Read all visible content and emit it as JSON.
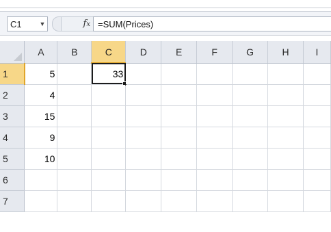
{
  "formula_bar": {
    "name_box": "C1",
    "fx_label": "fx",
    "formula": "=SUM(Prices)"
  },
  "columns": [
    "A",
    "B",
    "C",
    "D",
    "E",
    "F",
    "G",
    "H",
    "I"
  ],
  "rows": [
    {
      "label": "1",
      "cells": [
        "5",
        "",
        "33",
        "",
        "",
        "",
        "",
        "",
        ""
      ]
    },
    {
      "label": "2",
      "cells": [
        "4",
        "",
        "",
        "",
        "",
        "",
        "",
        "",
        ""
      ]
    },
    {
      "label": "3",
      "cells": [
        "15",
        "",
        "",
        "",
        "",
        "",
        "",
        "",
        ""
      ]
    },
    {
      "label": "4",
      "cells": [
        "9",
        "",
        "",
        "",
        "",
        "",
        "",
        "",
        ""
      ]
    },
    {
      "label": "5",
      "cells": [
        "10",
        "",
        "",
        "",
        "",
        "",
        "",
        "",
        ""
      ]
    },
    {
      "label": "6",
      "cells": [
        "",
        "",
        "",
        "",
        "",
        "",
        "",
        "",
        ""
      ]
    },
    {
      "label": "7",
      "cells": [
        "",
        "",
        "",
        "",
        "",
        "",
        "",
        "",
        ""
      ]
    }
  ],
  "active_cell": {
    "row": 0,
    "col": 2
  },
  "colors": {
    "selection_header": "#f7d788",
    "selection_accent": "#e0a52a"
  }
}
